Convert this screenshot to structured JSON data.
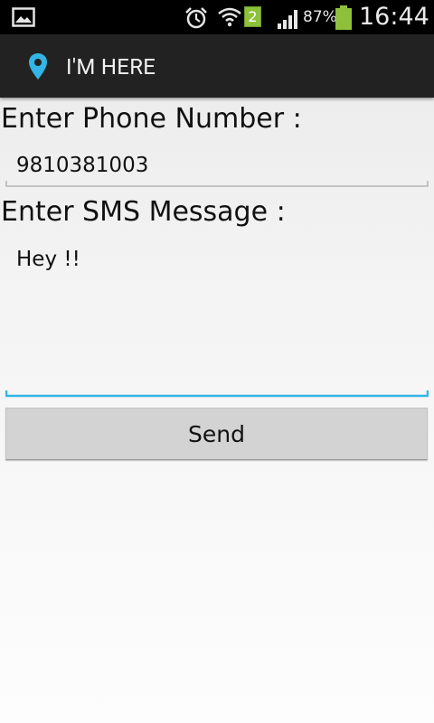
{
  "status_bar": {
    "battery_percent": "87%",
    "sim_badge": "2",
    "time": "16:44",
    "icons": [
      "image-notification-icon",
      "alarm-icon",
      "wifi-icon",
      "signal-icon",
      "battery-icon"
    ]
  },
  "action_bar": {
    "title": "I'M HERE",
    "icon": "location-pin-icon",
    "icon_color": "#33b5e5"
  },
  "form": {
    "phone_label": "Enter Phone Number :",
    "phone_value": "9810381003",
    "sms_label": "Enter SMS Message :",
    "sms_value": "Hey !!",
    "send_label": "Send",
    "focus_color": "#33b5e5"
  }
}
